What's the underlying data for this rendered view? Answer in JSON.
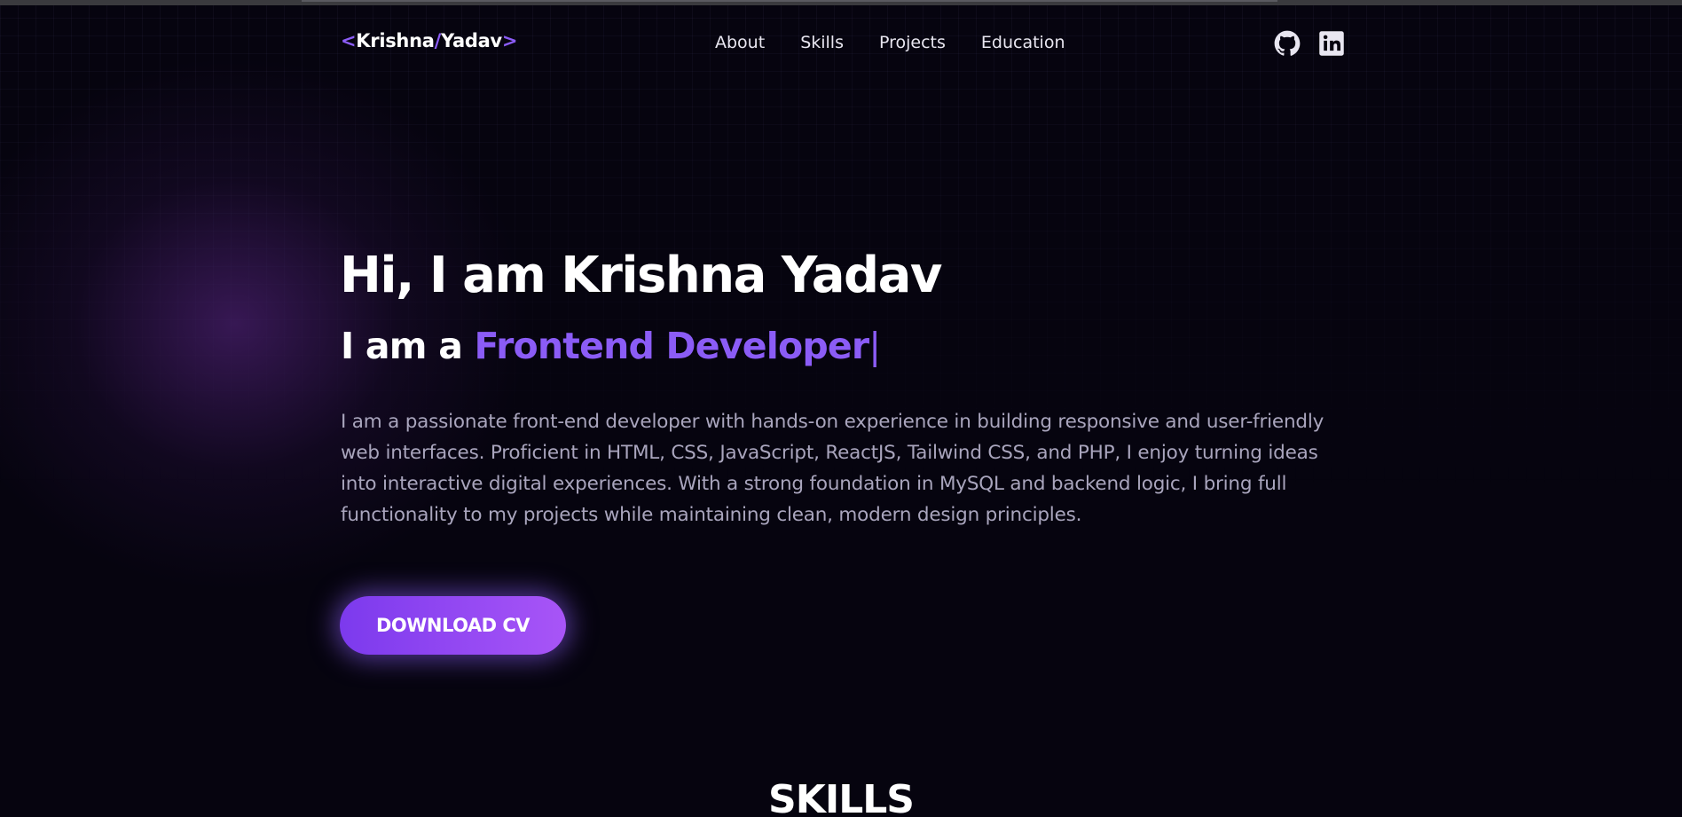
{
  "header": {
    "logo": {
      "open_bracket": "<",
      "first_name": "Krishna",
      "slash": "/",
      "last_name": "Yadav",
      "close_bracket": ">"
    },
    "nav": [
      {
        "label": "About"
      },
      {
        "label": "Skills"
      },
      {
        "label": "Projects"
      },
      {
        "label": "Education"
      }
    ],
    "social": [
      {
        "icon": "github-icon"
      },
      {
        "icon": "linkedin-icon"
      }
    ]
  },
  "hero": {
    "title": "Hi, I am Krishna Yadav",
    "subtitle_prefix": "I am a ",
    "subtitle_role": "Frontend Developer",
    "subtitle_cursor": "|",
    "description": "I am a passionate front-end developer with hands-on experience in building responsive and user-friendly web interfaces. Proficient in HTML, CSS, JavaScript, ReactJS, Tailwind CSS, and PHP, I enjoy turning ideas into interactive digital experiences. With a strong foundation in MySQL and backend logic, I bring full functionality to my projects while maintaining clean, modern design principles.",
    "cta_label": "DOWNLOAD CV"
  },
  "skills": {
    "heading": "SKILLS"
  },
  "colors": {
    "accent": "#8b5cf6",
    "background": "#06040f",
    "text": "#ffffff",
    "muted_text": "#a9a5bd"
  }
}
